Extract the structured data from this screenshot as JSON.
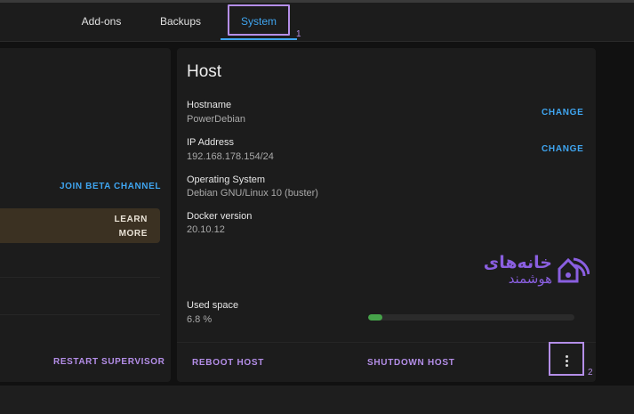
{
  "tabs": [
    {
      "label": "Add-ons"
    },
    {
      "label": "Backups"
    },
    {
      "label": "System",
      "active": true
    }
  ],
  "annotations": {
    "marker1": "1",
    "marker2": "2"
  },
  "left_card": {
    "beta_label": "JOIN BETA CHANNEL",
    "learn_more_label": "LEARN MORE",
    "restart_label": "RESTART SUPERVISOR"
  },
  "host": {
    "title": "Host",
    "hostname_label": "Hostname",
    "hostname_value": "PowerDebian",
    "ip_label": "IP Address",
    "ip_value": "192.168.178.154/24",
    "os_label": "Operating System",
    "os_value": "Debian GNU/Linux 10 (buster)",
    "docker_label": "Docker version",
    "docker_value": "20.10.12",
    "change_label": "CHANGE",
    "used_space_label": "Used space",
    "used_space_value": "6.8 %",
    "used_space_fraction": 0.068,
    "reboot_label": "REBOOT HOST",
    "shutdown_label": "SHUTDOWN HOST"
  },
  "watermark": {
    "line1": "خانه‌های",
    "line2": "هوشمند",
    "icon": "wifi-house-icon"
  },
  "colors": {
    "accent_blue": "#3fa5f0",
    "accent_purple": "#b48ee8",
    "progress_green": "#46a34a",
    "card_bg": "#1c1c1c"
  }
}
